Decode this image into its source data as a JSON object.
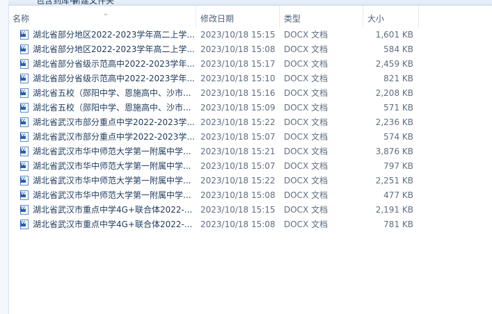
{
  "toolbar": {
    "item1": "包含到库中",
    "item2": "新建文件夹"
  },
  "columns": {
    "name": "名称",
    "date": "修改日期",
    "type": "类型",
    "size": "大小"
  },
  "files": [
    {
      "name": "湖北省部分地区2022-2023学年高二上学...",
      "date": "2023/10/18 15:15",
      "type": "DOCX 文档",
      "size": "1,601 KB"
    },
    {
      "name": "湖北省部分地区2022-2023学年高二上学...",
      "date": "2023/10/18 15:08",
      "type": "DOCX 文档",
      "size": "584 KB"
    },
    {
      "name": "湖北省部分省级示范高中2022-2023学年...",
      "date": "2023/10/18 15:17",
      "type": "DOCX 文档",
      "size": "2,459 KB"
    },
    {
      "name": "湖北省部分省级示范高中2022-2023学年...",
      "date": "2023/10/18 15:10",
      "type": "DOCX 文档",
      "size": "821 KB"
    },
    {
      "name": "湖北省五校（郧阳中学、恩施高中、沙市...",
      "date": "2023/10/18 15:16",
      "type": "DOCX 文档",
      "size": "2,208 KB"
    },
    {
      "name": "湖北省五校（郧阳中学、恩施高中、沙市...",
      "date": "2023/10/18 15:09",
      "type": "DOCX 文档",
      "size": "571 KB"
    },
    {
      "name": "湖北省武汉市部分重点中学2022-2023学...",
      "date": "2023/10/18 15:22",
      "type": "DOCX 文档",
      "size": "2,236 KB"
    },
    {
      "name": "湖北省武汉市部分重点中学2022-2023学...",
      "date": "2023/10/18 15:07",
      "type": "DOCX 文档",
      "size": "574 KB"
    },
    {
      "name": "湖北省武汉市华中师范大学第一附属中学...",
      "date": "2023/10/18 15:21",
      "type": "DOCX 文档",
      "size": "3,876 KB"
    },
    {
      "name": "湖北省武汉市华中师范大学第一附属中学...",
      "date": "2023/10/18 15:07",
      "type": "DOCX 文档",
      "size": "797 KB"
    },
    {
      "name": "湖北省武汉市华中师范大学第一附属中学...",
      "date": "2023/10/18 15:22",
      "type": "DOCX 文档",
      "size": "2,251 KB"
    },
    {
      "name": "湖北省武汉市华中师范大学第一附属中学...",
      "date": "2023/10/18 15:08",
      "type": "DOCX 文档",
      "size": "477 KB"
    },
    {
      "name": "湖北省武汉市重点中学4G+联合体2022-...",
      "date": "2023/10/18 15:15",
      "type": "DOCX 文档",
      "size": "2,191 KB"
    },
    {
      "name": "湖北省武汉市重点中学4G+联合体2022-...",
      "date": "2023/10/18 15:08",
      "type": "DOCX 文档",
      "size": "781 KB"
    }
  ]
}
